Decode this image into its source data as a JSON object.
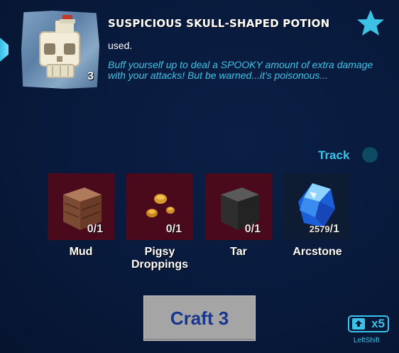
{
  "item": {
    "title": "SUSPICIOUS SKULL-SHAPED POTION",
    "count": "3",
    "status": "used.",
    "description": "Buff yourself up to deal a SPOOKY amount of extra damage with your attacks! But be warned...it's poisonous...",
    "icon": "skull-potion-icon"
  },
  "favorite": {
    "icon": "star-icon",
    "color": "#3cc2e6"
  },
  "track": {
    "label": "Track",
    "enabled": false
  },
  "ingredients": [
    {
      "name": "Mud",
      "have": "0",
      "need": "/1",
      "icon": "mud-block-icon"
    },
    {
      "name": "Pigsy Droppings",
      "have": "0",
      "need": "/1",
      "icon": "droppings-icon"
    },
    {
      "name": "Tar",
      "have": "0",
      "need": "/1",
      "icon": "tar-block-icon"
    },
    {
      "name": "Arcstone",
      "have": "2579",
      "need": "/1",
      "icon": "arcstone-crystal-icon"
    }
  ],
  "craft": {
    "label": "Craft 3"
  },
  "shift": {
    "multiplier": "x5",
    "key_label": "LeftShift"
  },
  "colors": {
    "accent": "#3cc2e6",
    "missing_slot": "#4a0a1c",
    "craft_text": "#16358f"
  }
}
